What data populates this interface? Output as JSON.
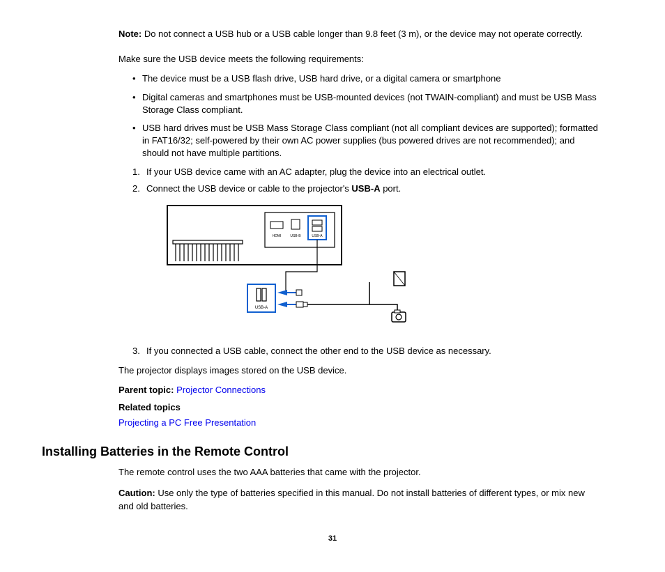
{
  "note": {
    "label": "Note:",
    "text": " Do not connect a USB hub or a USB cable longer than 9.8 feet (3 m), or the device may not operate correctly."
  },
  "intro": "Make sure the USB device meets the following requirements:",
  "bullets": [
    "The device must be a USB flash drive, USB hard drive, or a digital camera or smartphone",
    "Digital cameras and smartphones must be USB-mounted devices (not TWAIN-compliant) and must be USB Mass Storage Class compliant.",
    "USB hard drives must be USB Mass Storage Class compliant (not all compliant devices are supported); formatted in FAT16/32; self-powered by their own AC power supplies (bus powered drives are not recommended); and should not have multiple partitions."
  ],
  "steps12": [
    {
      "num": "1.",
      "text": "If your USB device came with an AC adapter, plug the device into an electrical outlet."
    },
    {
      "num": "2.",
      "prefix": "Connect the USB device or cable to the projector's ",
      "bold": "USB-A",
      "suffix": " port."
    }
  ],
  "step3_num": "3.",
  "step3_text": "If you connected a USB cable, connect the other end to the USB device as necessary.",
  "result": "The projector displays images stored on the USB device.",
  "parent_label": "Parent topic:",
  "parent_link": "Projector Connections",
  "related_label": "Related topics",
  "related_link": "Projecting a PC Free Presentation",
  "section_heading": "Installing Batteries in the Remote Control",
  "section_intro": "The remote control uses the two AAA batteries that came with the projector.",
  "caution": {
    "label": "Caution:",
    "text": " Use only the type of batteries specified in this manual. Do not install batteries of different types, or mix new and old batteries."
  },
  "page_number": "31",
  "figure": {
    "ports": {
      "hdmi": "HDMI",
      "usbb": "USB-B",
      "usba": "USB-A"
    },
    "callout": "USB-A"
  }
}
